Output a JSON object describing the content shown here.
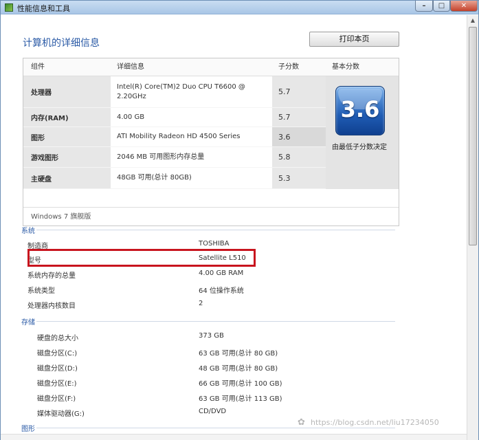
{
  "window": {
    "title": "性能信息和工具",
    "min_symbol": "–",
    "max_symbol": "□",
    "close_symbol": "✕"
  },
  "page": {
    "title": "计算机的详细信息",
    "print_label": "打印本页"
  },
  "components_table": {
    "headers": [
      "组件",
      "详细信息",
      "子分数",
      "基本分数"
    ],
    "rows": [
      {
        "component": "处理器",
        "details": "Intel(R) Core(TM)2 Duo CPU T6600 @ 2.20GHz",
        "subscore": "5.7"
      },
      {
        "component": "内存(RAM)",
        "details": "4.00 GB",
        "subscore": "5.7"
      },
      {
        "component": "图形",
        "details": "ATI Mobility Radeon HD 4500 Series",
        "subscore": "3.6"
      },
      {
        "component": "游戏图形",
        "details": "2046 MB 可用图形内存总量",
        "subscore": "5.8"
      },
      {
        "component": "主硬盘",
        "details": "48GB 可用(总计 80GB)",
        "subscore": "5.3"
      }
    ],
    "base_score": "3.6",
    "base_score_caption": "由最低子分数决定",
    "edition": "Windows 7 旗舰版"
  },
  "system": {
    "heading": "系统",
    "rows": [
      {
        "label": "制造商",
        "value": "TOSHIBA"
      },
      {
        "label": "型号",
        "value": "Satellite L510"
      },
      {
        "label": "系统内存的总量",
        "value": "4.00 GB RAM"
      },
      {
        "label": "系统类型",
        "value": "64 位操作系统"
      },
      {
        "label": "处理器内核数目",
        "value": "2"
      }
    ]
  },
  "storage": {
    "heading": "存储",
    "rows": [
      {
        "label": "硬盘的总大小",
        "value": "373 GB"
      },
      {
        "label": "磁盘分区(C:)",
        "value": "63 GB 可用(总计 80 GB)"
      },
      {
        "label": "磁盘分区(D:)",
        "value": "48 GB 可用(总计 80 GB)"
      },
      {
        "label": "磁盘分区(E:)",
        "value": "66 GB 可用(总计 100 GB)"
      },
      {
        "label": "磁盘分区(F:)",
        "value": "63 GB 可用(总计 113 GB)"
      },
      {
        "label": "媒体驱动器(G:)",
        "value": "CD/DVD"
      }
    ]
  },
  "graphics": {
    "heading": "图形"
  },
  "watermark": "https://blog.csdn.net/liu17234050"
}
